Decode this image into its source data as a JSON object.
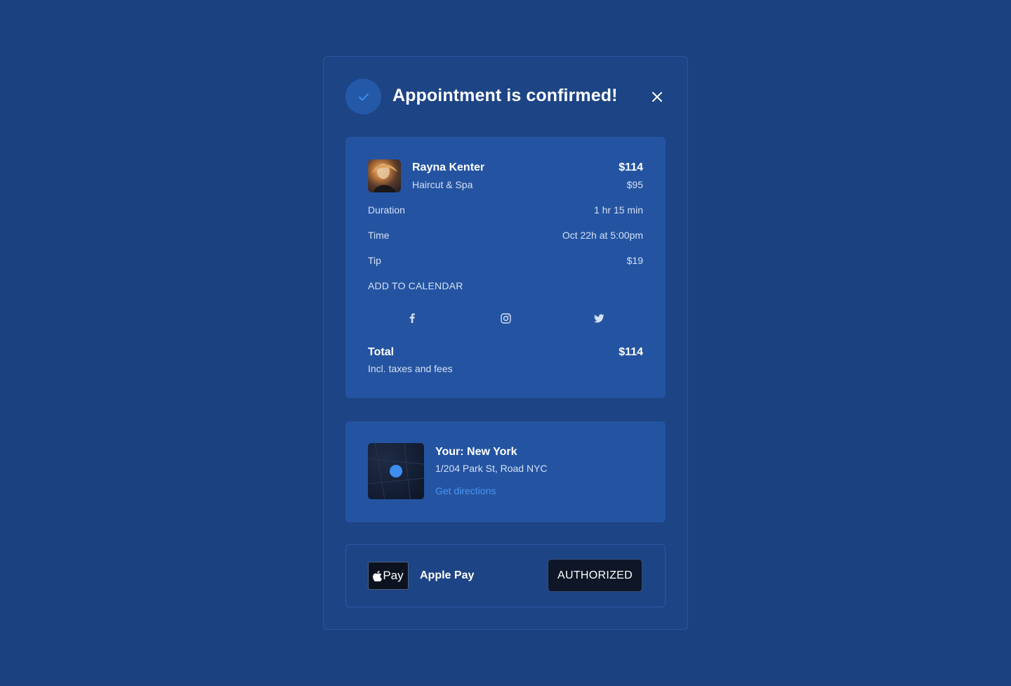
{
  "modal": {
    "title": "Appointment is confirmed!",
    "icons": {
      "check": "check-icon",
      "close": "close-icon"
    }
  },
  "booking": {
    "stylist_name": "Rayna Kenter",
    "service": "Haircut & Spa",
    "price": "$114",
    "original_price": "$95",
    "details": [
      {
        "label": "Duration",
        "value": "1 hr 15 min"
      },
      {
        "label": "Time",
        "value": "Oct 22h at 5:00pm"
      },
      {
        "label": "Tip",
        "value": "$19"
      }
    ],
    "add_to_calendar": "ADD TO CALENDAR",
    "social": [
      "facebook-icon",
      "instagram-icon",
      "twitter-icon"
    ],
    "total_label": "Total",
    "total_note": "Incl. taxes and fees",
    "total_value": "$114"
  },
  "location": {
    "title": "Your: New York",
    "address": "1/204 Park St, Road NYC",
    "directions_label": "Get directions"
  },
  "payment": {
    "logo_text": "Pay",
    "method": "Apple Pay",
    "status": "AUTHORIZED"
  },
  "colors": {
    "background": "#1b427f",
    "card": "#2454a1",
    "accent": "#4a95f5",
    "button_dark": "#0e1627"
  }
}
